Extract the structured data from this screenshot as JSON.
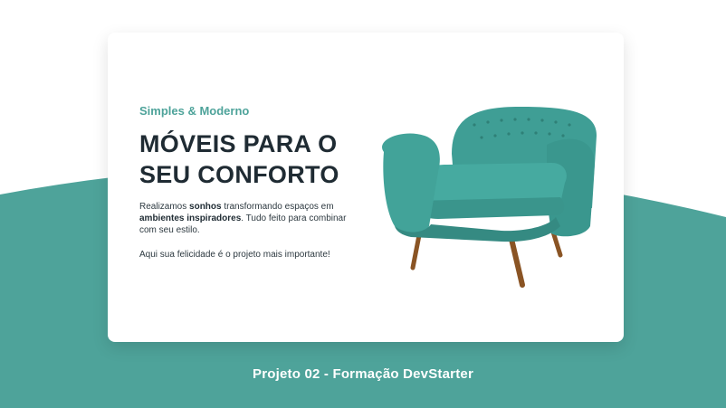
{
  "hero": {
    "eyebrow": "Simples & Moderno",
    "headline_line1": "MÓVEIS PARA O",
    "headline_line2": "SEU CONFORTO",
    "desc_part1": "Realizamos ",
    "desc_bold1": "sonhos",
    "desc_part2": " transformando espaços em ",
    "desc_bold2": "ambientes inspiradores",
    "desc_part3": ". Tudo feito para combinar com seu estilo.",
    "tagline": "Aqui sua felicidade é o projeto mais importante!"
  },
  "footer": {
    "caption": "Projeto 02 - Formação DevStarter"
  },
  "colors": {
    "accent": "#4ea39a",
    "heading": "#1f2b33",
    "chair_fabric": "#3f9e95",
    "chair_legs": "#8a5424"
  },
  "icons": {
    "chair_image": "armchair-icon"
  }
}
